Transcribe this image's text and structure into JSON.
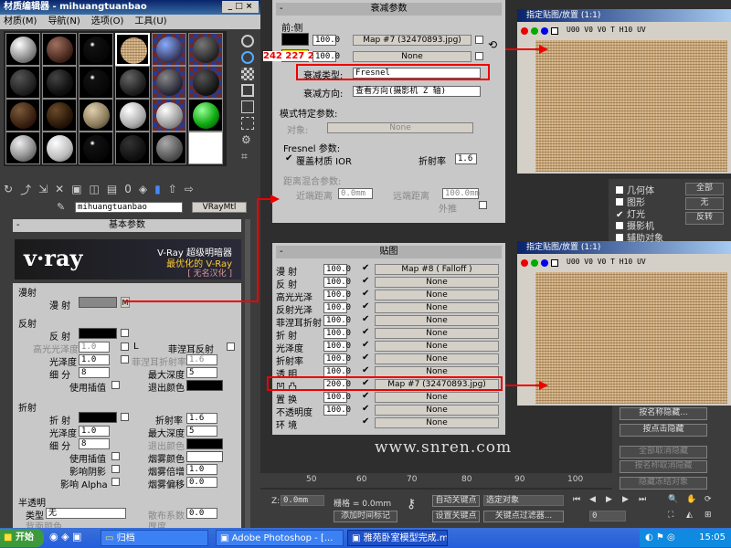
{
  "mat_editor": {
    "title": "材质编辑器 - mihuangtuanbao",
    "menu": [
      "材质(M)",
      "导航(N)",
      "选项(O)",
      "工具(U)"
    ],
    "material_name": "mihuangtuanbao",
    "material_type": "VRayMtl",
    "rollout_basic": "基本参数",
    "logo": "v·ray",
    "logo_line1": "V-Ray 超级明暗器",
    "logo_line2": "最优化的 V-Ray",
    "logo_line3": "[ 无名汉化 ]",
    "diffuse_group": "漫射",
    "diffuse_label": "漫 射",
    "diffuse_btn": "M",
    "reflect_group": "反射",
    "reflect_label": "反 射",
    "highlight_gloss": "高光光泽度",
    "highlight_value": "1.0",
    "l_btn": "L",
    "fresnel_reflect": "菲涅耳反射",
    "gloss": "光泽度",
    "gloss_value": "1.0",
    "fresnel_ior": "菲涅耳折射率",
    "fresnel_ior_value": "1.6",
    "subdiv": "细 分",
    "subdiv_value": "8",
    "max_depth": "最大深度",
    "max_depth_value": "5",
    "use_interp": "使用插值",
    "exit_color": "退出颜色",
    "refract_group": "折射",
    "refract_label": "折 射",
    "ior": "折射率",
    "ior_value": "1.6",
    "r_gloss": "光泽度",
    "r_gloss_value": "1.0",
    "r_max_depth": "最大深度",
    "r_max_depth_value": "5",
    "r_subdiv": "细 分",
    "r_subdiv_value": "8",
    "r_exit_color": "退出颜色",
    "r_use_interp": "使用插值",
    "fog_color": "烟雾颜色",
    "affect_shadow": "影响阴影",
    "fog_mult": "烟雾倍增",
    "fog_mult_value": "1.0",
    "affect_alpha": "影响 Alpha",
    "fog_bias": "烟雾偏移",
    "fog_bias_value": "0.0",
    "translucency": "半透明",
    "type_label": "类型",
    "type_value": "无",
    "scatter_coef": "散布系数",
    "scatter_coef_value": "0.0",
    "back_color": "背面颜色",
    "thickness": "厚度"
  },
  "falloff": {
    "title": "衰减参数",
    "front_side": "前:侧",
    "v1": "100.0",
    "map1": "Map #7  (32470893.jpg)",
    "v2": "100.0",
    "map2": "None",
    "rgb": "242 227 2",
    "falloff_type_label": "衰减类型:",
    "falloff_type": "Fresnel",
    "dir_label": "衰减方向:",
    "dir_value": "查看方向(摄影机 Z 轴)",
    "mode_params": "模式特定参数:",
    "object_label": "对象:",
    "object_value": "None",
    "fresnel_params": "Fresnel 参数:",
    "override_ior": "覆盖材质 IOR",
    "ior_label": "折射率",
    "ior_value": "1.6",
    "dist_mix": "距离混合参数:",
    "near": "近端距离",
    "near_value": "0.0mm",
    "far": "远端距离",
    "far_value": "100.0mm",
    "extrap": "外推"
  },
  "maps": {
    "title": "贴图",
    "rows": [
      {
        "name": "漫 射",
        "value": "100.0",
        "map": "Map #8  ( Falloff )"
      },
      {
        "name": "反 射",
        "value": "100.0",
        "map": "None"
      },
      {
        "name": "高光光泽",
        "value": "100.0",
        "map": "None"
      },
      {
        "name": "反射光泽",
        "value": "100.0",
        "map": "None"
      },
      {
        "name": "菲涅耳折射",
        "value": "100.0",
        "map": "None"
      },
      {
        "name": "折 射",
        "value": "100.0",
        "map": "None"
      },
      {
        "name": "光泽度",
        "value": "100.0",
        "map": "None"
      },
      {
        "name": "折射率",
        "value": "100.0",
        "map": "None"
      },
      {
        "name": "透 明",
        "value": "100.0",
        "map": "None"
      },
      {
        "name": "凹 凸",
        "value": "200.0",
        "map": "Map #7  (32470893.jpg)"
      },
      {
        "name": "置 换",
        "value": "100.0",
        "map": "None"
      },
      {
        "name": "不透明度",
        "value": "100.0",
        "map": "None"
      },
      {
        "name": "环 境",
        "value": "",
        "map": "None"
      }
    ]
  },
  "viewer_top": {
    "title": "指定贴图/放置 (1:1)",
    "channels": "U00 V0 V0 T H10 UV"
  },
  "viewer_bottom": {
    "title": "指定贴图/放置 (1:1)",
    "channels": "U00 V0 V0 T H10 UV"
  },
  "side_panel": {
    "items": [
      "几何体",
      "图形",
      "灯光",
      "摄影机",
      "辅助对象"
    ],
    "btn_all": "全部",
    "btn_none": "无",
    "btn_invert": "反转"
  },
  "lower_buttons": {
    "b1": "按名称隐藏...",
    "b2": "按点击隐藏",
    "b3": "全部取消隐藏",
    "b4": "按名称取消隐藏",
    "b5": "隐藏冻结对象"
  },
  "watermark": "www.snren.com",
  "timeline": {
    "ticks": [
      "50",
      "60",
      "70",
      "80",
      "90",
      "100"
    ],
    "z_label": "Z:",
    "z_value": "0.0mm",
    "grid": "栅格 = 0.0mm",
    "auto_key": "自动关键点",
    "selected": "选定对象",
    "set_key": "设置关键点",
    "key_filter": "关键点过滤器...",
    "add_time_tag": "添加时间标记",
    "frame": "0"
  },
  "taskbar": {
    "start": "开始",
    "folder": "归档",
    "photoshop": "Adobe Photoshop - [...",
    "max": "雅苑卧室模型完成.ma...",
    "clock": "15:05"
  }
}
